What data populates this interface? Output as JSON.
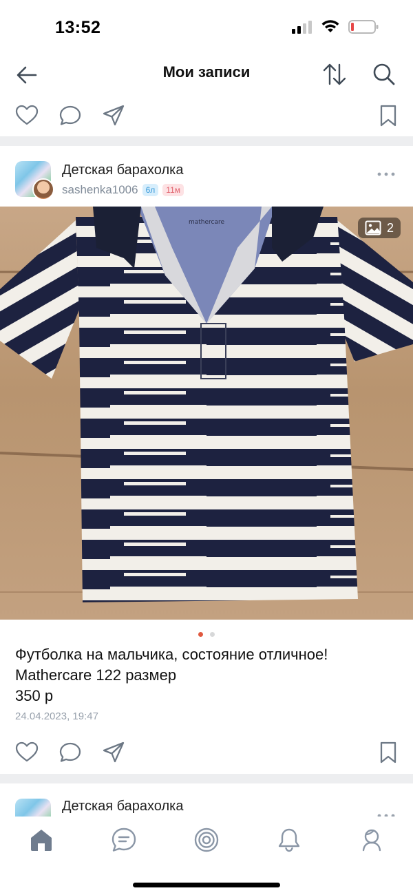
{
  "status_bar": {
    "time": "13:52",
    "battery_color": "#e64646"
  },
  "header": {
    "title": "Мои записи"
  },
  "colors": {
    "accent": "#e64646",
    "icon": "#6d7885",
    "secondary_text": "#818c99",
    "tab_active": "#6f7c8e",
    "divider": "#edeef0"
  },
  "post": {
    "group_name": "Детская барахолка",
    "author": "sashenka1006",
    "badges": [
      "6л",
      "11м"
    ],
    "photo_count": "2",
    "photo_subject": "striped-polo-shirt",
    "text_lines": [
      "Футболка на мальчика, состояние отличное!",
      "Mathercare 122 размер",
      "350 р"
    ],
    "date": "24.04.2023, 19:47",
    "carousel_total": 2,
    "carousel_active": 1
  },
  "next_post": {
    "group_name": "Детская барахолка"
  },
  "tabbar": {
    "items": [
      {
        "icon": "home-icon",
        "active": true
      },
      {
        "icon": "chat-icon",
        "active": false
      },
      {
        "icon": "discover-icon",
        "active": false
      },
      {
        "icon": "bell-icon",
        "active": false
      },
      {
        "icon": "profile-icon",
        "active": false
      }
    ]
  }
}
